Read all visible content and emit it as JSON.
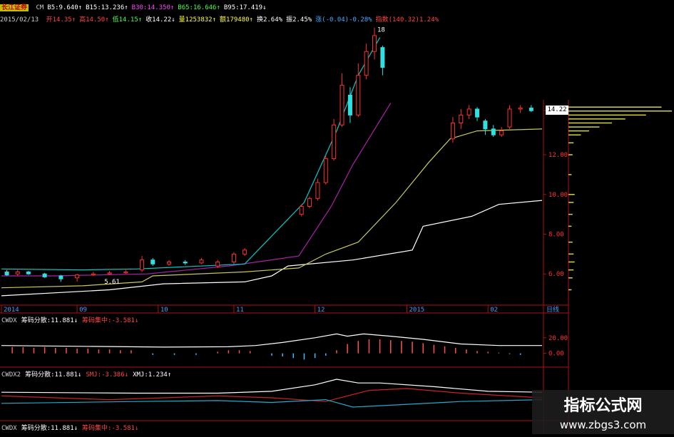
{
  "header": {
    "broker": "长江证券",
    "ma_labels": [
      {
        "text": "CM",
        "color": "#cccccc"
      },
      {
        "text": "B5:9.640↑",
        "color": "#ffffff"
      },
      {
        "text": "B15:13.236↑",
        "color": "#ffffff"
      },
      {
        "text": "B30:14.350↑",
        "color": "#ff44ff"
      },
      {
        "text": "B65:16.646↑",
        "color": "#44ff44"
      },
      {
        "text": "B95:17.419↓",
        "color": "#ffffff"
      }
    ],
    "date": "2015/02/13",
    "quote_labels": [
      {
        "text": "开14.35↑",
        "color": "#ff4444"
      },
      {
        "text": "高14.50↑",
        "color": "#ff4444"
      },
      {
        "text": "低14.15↑",
        "color": "#44ff44"
      },
      {
        "text": "收14.22↓",
        "color": "#ffffff"
      },
      {
        "text": "量1253832↑",
        "color": "#ffff44"
      },
      {
        "text": "额179480↑",
        "color": "#ffff44"
      },
      {
        "text": "换2.64%",
        "color": "#ffffff"
      },
      {
        "text": "振2.45%",
        "color": "#ffffff"
      },
      {
        "text": "涨(-0.04)-0.28%",
        "color": "#44aaff"
      },
      {
        "text": "指数(140.32)1.24%",
        "color": "#ff4444"
      }
    ]
  },
  "chart_data": {
    "type": "line",
    "title": "",
    "x_ticks": [
      "2014",
      "09",
      "10",
      "11",
      "12",
      "2015",
      "02",
      "日线"
    ],
    "y_ticks": [
      14.22,
      12.0,
      10.0,
      8.0,
      6.0
    ],
    "ylim": [
      4.5,
      18.5
    ],
    "annotations": [
      {
        "text": "5.61",
        "x": 0.185,
        "y": 5.61
      },
      {
        "text": "18",
        "x": 0.69,
        "y": 18.3
      }
    ],
    "current_price": "14.22",
    "series": [
      {
        "color": "#ffffff",
        "points": [
          [
            0,
            4.9
          ],
          [
            0.2,
            5.2
          ],
          [
            0.3,
            5.5
          ],
          [
            0.45,
            5.6
          ],
          [
            0.5,
            5.9
          ],
          [
            0.53,
            6.4
          ],
          [
            0.65,
            6.7
          ],
          [
            0.76,
            7.2
          ],
          [
            0.78,
            8.4
          ],
          [
            0.87,
            8.9
          ],
          [
            0.92,
            9.5
          ],
          [
            1.0,
            9.7
          ]
        ]
      },
      {
        "color": "#c8c85a",
        "points": [
          [
            0,
            5.3
          ],
          [
            0.15,
            5.4
          ],
          [
            0.26,
            5.6
          ],
          [
            0.28,
            5.9
          ],
          [
            0.45,
            6.1
          ],
          [
            0.55,
            6.3
          ],
          [
            0.6,
            7.0
          ],
          [
            0.66,
            7.6
          ],
          [
            0.73,
            9.6
          ],
          [
            0.79,
            11.6
          ],
          [
            0.83,
            12.8
          ],
          [
            0.88,
            13.2
          ],
          [
            1.0,
            13.3
          ]
        ]
      },
      {
        "color": "#aa22aa",
        "points": [
          [
            0,
            5.9
          ],
          [
            0.1,
            5.9
          ],
          [
            0.27,
            6.0
          ],
          [
            0.42,
            6.4
          ],
          [
            0.55,
            6.9
          ],
          [
            0.61,
            9.4
          ],
          [
            0.65,
            11.5
          ],
          [
            0.72,
            14.6
          ]
        ]
      },
      {
        "color": "#00cccc",
        "points": [
          [
            0,
            6.25
          ],
          [
            0.15,
            6.2
          ],
          [
            0.25,
            6.25
          ],
          [
            0.45,
            6.5
          ],
          [
            0.56,
            9.6
          ],
          [
            0.62,
            13.2
          ],
          [
            0.66,
            16.0
          ],
          [
            0.7,
            17.9
          ]
        ]
      }
    ],
    "candles": [
      {
        "x": 0.01,
        "o": 6.1,
        "c": 5.95,
        "h": 6.2,
        "l": 5.9
      },
      {
        "x": 0.03,
        "o": 6.0,
        "c": 6.1,
        "h": 6.2,
        "l": 5.9
      },
      {
        "x": 0.05,
        "o": 6.1,
        "c": 6.0,
        "h": 6.15,
        "l": 5.95
      },
      {
        "x": 0.08,
        "o": 6.0,
        "c": 5.85,
        "h": 6.05,
        "l": 5.8
      },
      {
        "x": 0.11,
        "o": 5.9,
        "c": 5.75,
        "h": 5.95,
        "l": 5.6
      },
      {
        "x": 0.14,
        "o": 5.8,
        "c": 5.95,
        "h": 6.0,
        "l": 5.61
      },
      {
        "x": 0.17,
        "o": 5.95,
        "c": 6.0,
        "h": 6.1,
        "l": 5.9
      },
      {
        "x": 0.2,
        "o": 6.0,
        "c": 6.05,
        "h": 6.15,
        "l": 5.95
      },
      {
        "x": 0.23,
        "o": 6.05,
        "c": 6.1,
        "h": 6.2,
        "l": 6.0
      },
      {
        "x": 0.26,
        "o": 6.2,
        "c": 6.7,
        "h": 6.9,
        "l": 6.1
      },
      {
        "x": 0.28,
        "o": 6.7,
        "c": 6.5,
        "h": 6.8,
        "l": 6.4
      },
      {
        "x": 0.31,
        "o": 6.5,
        "c": 6.6,
        "h": 6.7,
        "l": 6.4
      },
      {
        "x": 0.34,
        "o": 6.6,
        "c": 6.55,
        "h": 6.7,
        "l": 6.45
      },
      {
        "x": 0.37,
        "o": 6.55,
        "c": 6.7,
        "h": 6.8,
        "l": 6.5
      },
      {
        "x": 0.4,
        "o": 6.4,
        "c": 6.6,
        "h": 6.7,
        "l": 6.3
      },
      {
        "x": 0.43,
        "o": 6.6,
        "c": 7.0,
        "h": 7.1,
        "l": 6.5
      },
      {
        "x": 0.45,
        "o": 7.0,
        "c": 7.2,
        "h": 7.3,
        "l": 6.9
      },
      {
        "x": 0.555,
        "o": 9.0,
        "c": 9.4,
        "h": 9.5,
        "l": 8.9
      },
      {
        "x": 0.57,
        "o": 9.4,
        "c": 9.8,
        "h": 9.9,
        "l": 9.3
      },
      {
        "x": 0.585,
        "o": 9.8,
        "c": 10.6,
        "h": 10.8,
        "l": 9.7
      },
      {
        "x": 0.6,
        "o": 10.6,
        "c": 11.8,
        "h": 12.0,
        "l": 10.5
      },
      {
        "x": 0.615,
        "o": 11.8,
        "c": 13.5,
        "h": 13.8,
        "l": 11.7
      },
      {
        "x": 0.63,
        "o": 13.5,
        "c": 15.5,
        "h": 16.1,
        "l": 13.4
      },
      {
        "x": 0.645,
        "o": 15.0,
        "c": 14.0,
        "h": 15.4,
        "l": 13.6
      },
      {
        "x": 0.66,
        "o": 14.0,
        "c": 16.0,
        "h": 16.6,
        "l": 13.9
      },
      {
        "x": 0.675,
        "o": 16.0,
        "c": 17.2,
        "h": 17.6,
        "l": 15.8
      },
      {
        "x": 0.69,
        "o": 17.2,
        "c": 18.0,
        "h": 18.4,
        "l": 16.8
      },
      {
        "x": 0.705,
        "o": 17.4,
        "c": 16.4,
        "h": 17.5,
        "l": 16.0
      },
      {
        "x": 0.835,
        "o": 12.8,
        "c": 13.6,
        "h": 13.9,
        "l": 12.6
      },
      {
        "x": 0.85,
        "o": 13.6,
        "c": 14.0,
        "h": 14.3,
        "l": 13.3
      },
      {
        "x": 0.865,
        "o": 14.0,
        "c": 14.3,
        "h": 14.5,
        "l": 13.8
      },
      {
        "x": 0.88,
        "o": 14.3,
        "c": 13.9,
        "h": 14.4,
        "l": 13.7
      },
      {
        "x": 0.895,
        "o": 13.7,
        "c": 13.3,
        "h": 13.8,
        "l": 13.0
      },
      {
        "x": 0.91,
        "o": 13.3,
        "c": 13.0,
        "h": 13.5,
        "l": 12.9
      },
      {
        "x": 0.925,
        "o": 13.0,
        "c": 13.2,
        "h": 13.4,
        "l": 12.9
      },
      {
        "x": 0.94,
        "o": 13.4,
        "c": 14.3,
        "h": 14.5,
        "l": 13.3
      },
      {
        "x": 0.96,
        "o": 14.3,
        "c": 14.35,
        "h": 14.5,
        "l": 14.1
      },
      {
        "x": 0.98,
        "o": 14.35,
        "c": 14.22,
        "h": 14.5,
        "l": 14.15
      }
    ],
    "chip_profile": [
      {
        "y": 14.4,
        "v": 0.9
      },
      {
        "y": 14.2,
        "v": 1.0
      },
      {
        "y": 14.0,
        "v": 0.75
      },
      {
        "y": 13.8,
        "v": 0.55
      },
      {
        "y": 13.6,
        "v": 0.42
      },
      {
        "y": 13.4,
        "v": 0.3
      },
      {
        "y": 13.2,
        "v": 0.2
      },
      {
        "y": 13.0,
        "v": 0.12
      },
      {
        "y": 12.6,
        "v": 0.05
      },
      {
        "y": 12.0,
        "v": 0.04
      },
      {
        "y": 11.0,
        "v": 0.03
      },
      {
        "y": 10.0,
        "v": 0.06
      },
      {
        "y": 9.6,
        "v": 0.05
      },
      {
        "y": 9.0,
        "v": 0.04
      },
      {
        "y": 8.4,
        "v": 0.03
      },
      {
        "y": 7.6,
        "v": 0.04
      },
      {
        "y": 7.0,
        "v": 0.05
      },
      {
        "y": 6.6,
        "v": 0.06
      },
      {
        "y": 6.2,
        "v": 0.05
      },
      {
        "y": 5.8,
        "v": 0.04
      },
      {
        "y": 5.2,
        "v": 0.03
      }
    ],
    "indicators": [
      {
        "name": "CWDX",
        "labels": [
          {
            "text": "CWDX",
            "color": "#cccccc"
          },
          {
            "text": "筹码分散:11.881↓",
            "color": "#ffffff"
          },
          {
            "text": "筹码集中:-3.581↓",
            "color": "#ff4444"
          }
        ],
        "y_ticks": [
          20.0,
          0.0
        ],
        "ylim": [
          -15,
          40
        ],
        "line": [
          [
            0,
            10
          ],
          [
            0.15,
            9
          ],
          [
            0.3,
            8
          ],
          [
            0.42,
            8.5
          ],
          [
            0.47,
            10
          ],
          [
            0.52,
            14
          ],
          [
            0.58,
            20
          ],
          [
            0.62,
            25
          ],
          [
            0.64,
            22
          ],
          [
            0.67,
            25
          ],
          [
            0.72,
            22
          ],
          [
            0.78,
            18
          ],
          [
            0.85,
            12
          ],
          [
            0.92,
            10
          ],
          [
            1,
            10
          ]
        ],
        "bars": [
          [
            0.02,
            8
          ],
          [
            0.04,
            8
          ],
          [
            0.06,
            7
          ],
          [
            0.08,
            8
          ],
          [
            0.1,
            7
          ],
          [
            0.12,
            7
          ],
          [
            0.14,
            6
          ],
          [
            0.16,
            6
          ],
          [
            0.18,
            5
          ],
          [
            0.2,
            5
          ],
          [
            0.22,
            4
          ],
          [
            0.24,
            4
          ],
          [
            0.28,
            -2
          ],
          [
            0.32,
            -2
          ],
          [
            0.36,
            -2
          ],
          [
            0.4,
            2
          ],
          [
            0.42,
            4
          ],
          [
            0.44,
            4
          ],
          [
            0.46,
            3
          ],
          [
            0.5,
            -3
          ],
          [
            0.52,
            -4
          ],
          [
            0.54,
            -6
          ],
          [
            0.56,
            -8
          ],
          [
            0.58,
            -6
          ],
          [
            0.6,
            -3
          ],
          [
            0.62,
            4
          ],
          [
            0.64,
            12
          ],
          [
            0.66,
            16
          ],
          [
            0.68,
            18
          ],
          [
            0.7,
            18
          ],
          [
            0.72,
            17
          ],
          [
            0.74,
            16
          ],
          [
            0.76,
            15
          ],
          [
            0.78,
            13
          ],
          [
            0.8,
            11
          ],
          [
            0.82,
            9
          ],
          [
            0.84,
            7
          ],
          [
            0.86,
            5
          ],
          [
            0.88,
            3
          ],
          [
            0.9,
            2
          ],
          [
            0.92,
            1
          ],
          [
            0.94,
            -1
          ],
          [
            0.96,
            -2
          ]
        ]
      },
      {
        "name": "CWDX2",
        "labels": [
          {
            "text": "CWDX2",
            "color": "#cccccc"
          },
          {
            "text": "筹码分散:11.881↓",
            "color": "#ffffff"
          },
          {
            "text": "SMJ:-3.386↓",
            "color": "#ff4444"
          },
          {
            "text": "XMJ:1.234↑",
            "color": "#ffffff"
          }
        ],
        "lines": [
          {
            "color": "#ffffff",
            "points": [
              [
                0,
                6
              ],
              [
                0.25,
                5
              ],
              [
                0.4,
                5
              ],
              [
                0.5,
                7
              ],
              [
                0.58,
                14
              ],
              [
                0.62,
                20
              ],
              [
                0.66,
                16
              ],
              [
                0.7,
                16
              ],
              [
                0.8,
                12
              ],
              [
                0.9,
                7
              ],
              [
                1,
                6
              ]
            ]
          },
          {
            "color": "#cc2222",
            "points": [
              [
                0,
                2
              ],
              [
                0.2,
                -2
              ],
              [
                0.3,
                0
              ],
              [
                0.4,
                2
              ],
              [
                0.5,
                0
              ],
              [
                0.6,
                -4
              ],
              [
                0.68,
                8
              ],
              [
                0.75,
                10
              ],
              [
                0.85,
                5
              ],
              [
                1,
                0
              ]
            ]
          },
          {
            "color": "#22aacc",
            "points": [
              [
                0,
                -6
              ],
              [
                0.25,
                -4
              ],
              [
                0.4,
                -3
              ],
              [
                0.5,
                -5
              ],
              [
                0.6,
                -2
              ],
              [
                0.65,
                -10
              ],
              [
                0.72,
                -8
              ],
              [
                0.85,
                -4
              ],
              [
                1,
                -2
              ]
            ]
          }
        ]
      }
    ],
    "bottom_labels": [
      {
        "text": "CWDX",
        "color": "#cccccc"
      },
      {
        "text": "筹码分散:11.881↓",
        "color": "#ffffff"
      },
      {
        "text": "筹码集中:-3.581↓",
        "color": "#ff4444"
      }
    ]
  },
  "watermark": {
    "title": "指标公式网",
    "url": "www.zbgs3.com"
  }
}
